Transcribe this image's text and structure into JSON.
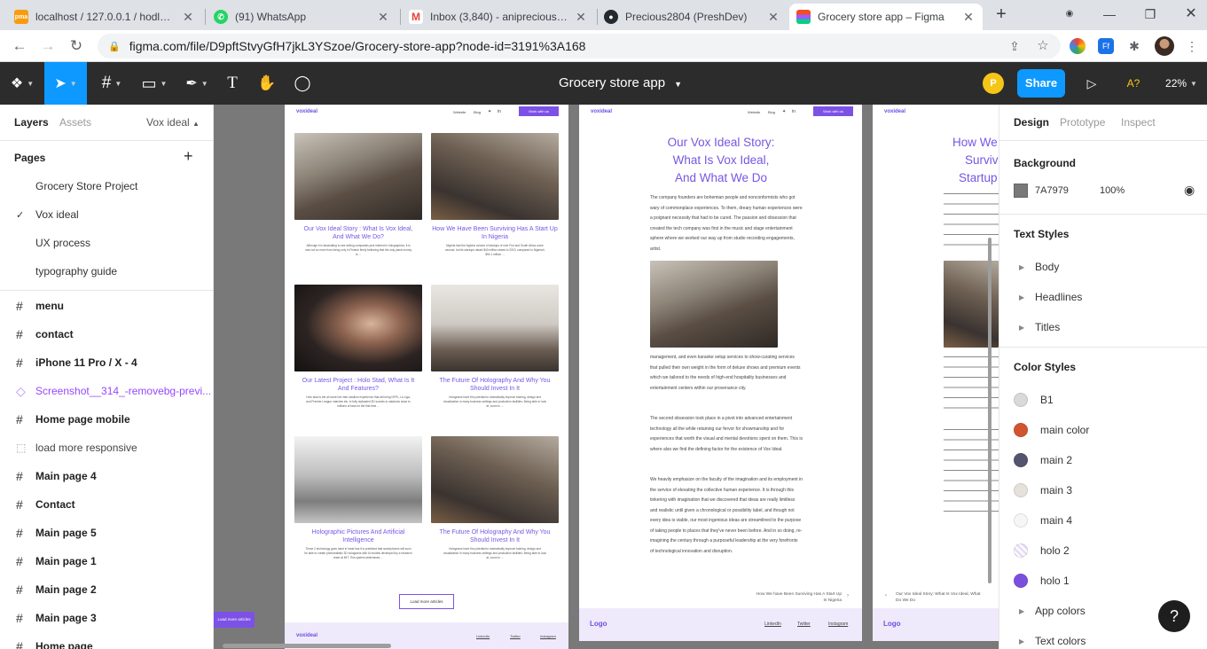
{
  "browser": {
    "tabs": [
      {
        "title": "localhost / 127.0.0.1 / hodlnau",
        "fav": "pma",
        "color": "#f89c0e"
      },
      {
        "title": "(91) WhatsApp",
        "fav": "whatsapp",
        "color": "#25d366"
      },
      {
        "title": "Inbox (3,840) - anipreciousebube",
        "fav": "gmail",
        "color": "#ea4335"
      },
      {
        "title": "Precious2804 (PreshDev)",
        "fav": "github",
        "color": "#24292e"
      },
      {
        "title": "Grocery store app – Figma",
        "fav": "figma",
        "color": "#a259ff"
      }
    ],
    "url": "figma.com/file/D9pftStvyGfH7jkL3YSzoe/Grocery-store-app?node-id=3191%3A168"
  },
  "figma": {
    "file_name": "Grocery store app",
    "share_label": "Share",
    "user_initial": "P",
    "ai_label": "A?",
    "zoom": "22%"
  },
  "left_panel": {
    "tab_layers": "Layers",
    "tab_assets": "Assets",
    "page_selector": "Vox ideal",
    "pages_heading": "Pages",
    "pages": [
      {
        "label": "Grocery Store Project",
        "current": false
      },
      {
        "label": "Vox ideal",
        "current": true
      },
      {
        "label": "UX process",
        "current": false
      },
      {
        "label": "typography guide",
        "current": false
      }
    ],
    "layers": [
      {
        "label": "menu",
        "icon": "frame",
        "style": "bold"
      },
      {
        "label": "contact",
        "icon": "frame",
        "style": "bold"
      },
      {
        "label": "iPhone 11 Pro / X - 4",
        "icon": "frame",
        "style": "bold"
      },
      {
        "label": "Screenshot__314_-removebg-previ...",
        "icon": "component",
        "style": "purple"
      },
      {
        "label": "Home page mobile",
        "icon": "frame",
        "style": "bold"
      },
      {
        "label": "load more responsive",
        "icon": "dashed-frame",
        "style": "thin"
      },
      {
        "label": "Main page 4",
        "icon": "frame",
        "style": "bold"
      },
      {
        "label": "Contact",
        "icon": "frame",
        "style": "bold"
      },
      {
        "label": "Main page 5",
        "icon": "frame",
        "style": "bold"
      },
      {
        "label": "Main page 1",
        "icon": "frame",
        "style": "bold"
      },
      {
        "label": "Main page 2",
        "icon": "frame",
        "style": "bold"
      },
      {
        "label": "Main page 3",
        "icon": "frame",
        "style": "bold"
      },
      {
        "label": "Home page",
        "icon": "frame",
        "style": "bold"
      }
    ]
  },
  "canvas": {
    "frame1": {
      "logo": "voxideal",
      "nav": [
        "Website",
        "Blog"
      ],
      "cta": "Work with us",
      "articles": [
        {
          "title": "Our Vox Ideal Story : What Is Vox Ideal, And What We Do?",
          "body": "Although it is fascinating to see writing companies pick interest in holographics, it is now not so more from being only in Fintech firmly believing that the only place money is ...",
          "more": "Read More"
        },
        {
          "title": "How We Have Been Surviving Has A Start Up In Nigeria",
          "body": "Nigeria had the highest volume of startups of over Fnd and South Africa come second, but its startups raised $40 million raised in 2019, compared to Nigeria's $94.1 million ...",
          "more": "Read More"
        },
        {
          "title": "Our Latest Project : Holo Stad, What Is It And Features?",
          "body": "Holo stad is the at home live inter-stadium experience that will bring NFPL, La Liga, and Premier League matches etc. in fully replicated 3D sounds to stadiums close to millions of fans for the first time ...",
          "more": "Read More"
        },
        {
          "title": "The Future Of Holography And Why You Should Invest In It",
          "body": "Holograms have the potential to dramatically improve training, design and visualization in many business settings and production facilities. Being able to look at, zoom in ...",
          "more": "Read More"
        },
        {
          "title": "Holographic Pictures And Artificial Intelligence",
          "body": "These 2 technology goes hand in hand has it is predicted that smartphones will soon be able to create photorealistic 3D holograms with AI models developed by a research team at MIT. This system determines ...",
          "more": "Read More"
        },
        {
          "title": "The Future Of Holography And Why You Should Invest In It",
          "body": "Holograms have the potential to dramatically improve training, design and visualization in many business settings and production facilities. Being able to look at, zoom in ...",
          "more": "Read More"
        }
      ],
      "load_more": "Load more articles",
      "footer_links": [
        "LinkedIn",
        "Twitter",
        "Instagram"
      ]
    },
    "frame2": {
      "title_lines": [
        "Our Vox Ideal Story:",
        "What Is Vox Ideal,",
        "And What We Do"
      ],
      "para1": "The company founders are bohemian people and nonconformists who got wary of commonplace experiences. To them, dreary human experiences were a poignant necessity that had to be cured. The passion and obsession that created the tech company was first in the music and stage entertainment sphere where we worked our way up from studio recording engagements, artist.",
      "para2": "management, and even karaoke setup services to show-curating services that pulled their own weight in the form of deluxe shows and premium events which we tailored to the needs of high-end hospitality businesses and entertainment centers within our provenance city.",
      "para3": "The second obsession took place in a pivot into advanced entertainment technology all the while retaining our fervor for showmanship and for experiences that worth the visual and mental devotions spent on them. This is where also we find the defining factor for the existence of Vox Ideal.",
      "para4": "We heavily emphasize on the faculty of the imagination and its employment in the service of elevating the collective human experience. It is through this tinkering with imagination that we discovered that ideas are really limitless and realistic until given a chronological or possibility label, and though not every idea is viable, our most ingenious ideas are streamlined to the purpose of taking people to places that they've never been before. And in so doing, re-imagining the century through a purposeful leadership at the very forefronts of technological innovation and disruption.",
      "next": "How We have Been Surviving Has A Start Up In Nigeria",
      "footer_logo": "Logo",
      "footer_links": [
        "LinkedIn",
        "Twitter",
        "Instagram"
      ]
    },
    "frame3": {
      "title_lines": [
        "How We",
        "Surviv",
        "Startup"
      ],
      "prev": "Our Vox Ideal Story: What Is Vox Ideal, What Do We Do",
      "footer_logo": "Logo"
    },
    "floating_button": "Load more articles"
  },
  "right_panel": {
    "tabs": [
      "Design",
      "Prototype",
      "Inspect"
    ],
    "background_heading": "Background",
    "background_hex": "7A7979",
    "background_color": "#7a7979",
    "background_opacity": "100%",
    "text_styles_heading": "Text Styles",
    "text_styles": [
      "Body",
      "Headlines",
      "Titles"
    ],
    "color_styles_heading": "Color Styles",
    "color_styles": [
      {
        "name": "B1",
        "color": "#d9d9d9"
      },
      {
        "name": "main color",
        "color": "#d2542e"
      },
      {
        "name": "main 2",
        "color": "#545470"
      },
      {
        "name": "main 3",
        "color": "#e6e1da"
      },
      {
        "name": "main 4",
        "color": "#f7f6f6"
      },
      {
        "name": "holo 2",
        "color": "#e9ddf6"
      },
      {
        "name": "holo 1",
        "color": "#7a4fe0"
      }
    ],
    "groups": [
      "App colors",
      "Text colors"
    ]
  },
  "help_label": "?"
}
